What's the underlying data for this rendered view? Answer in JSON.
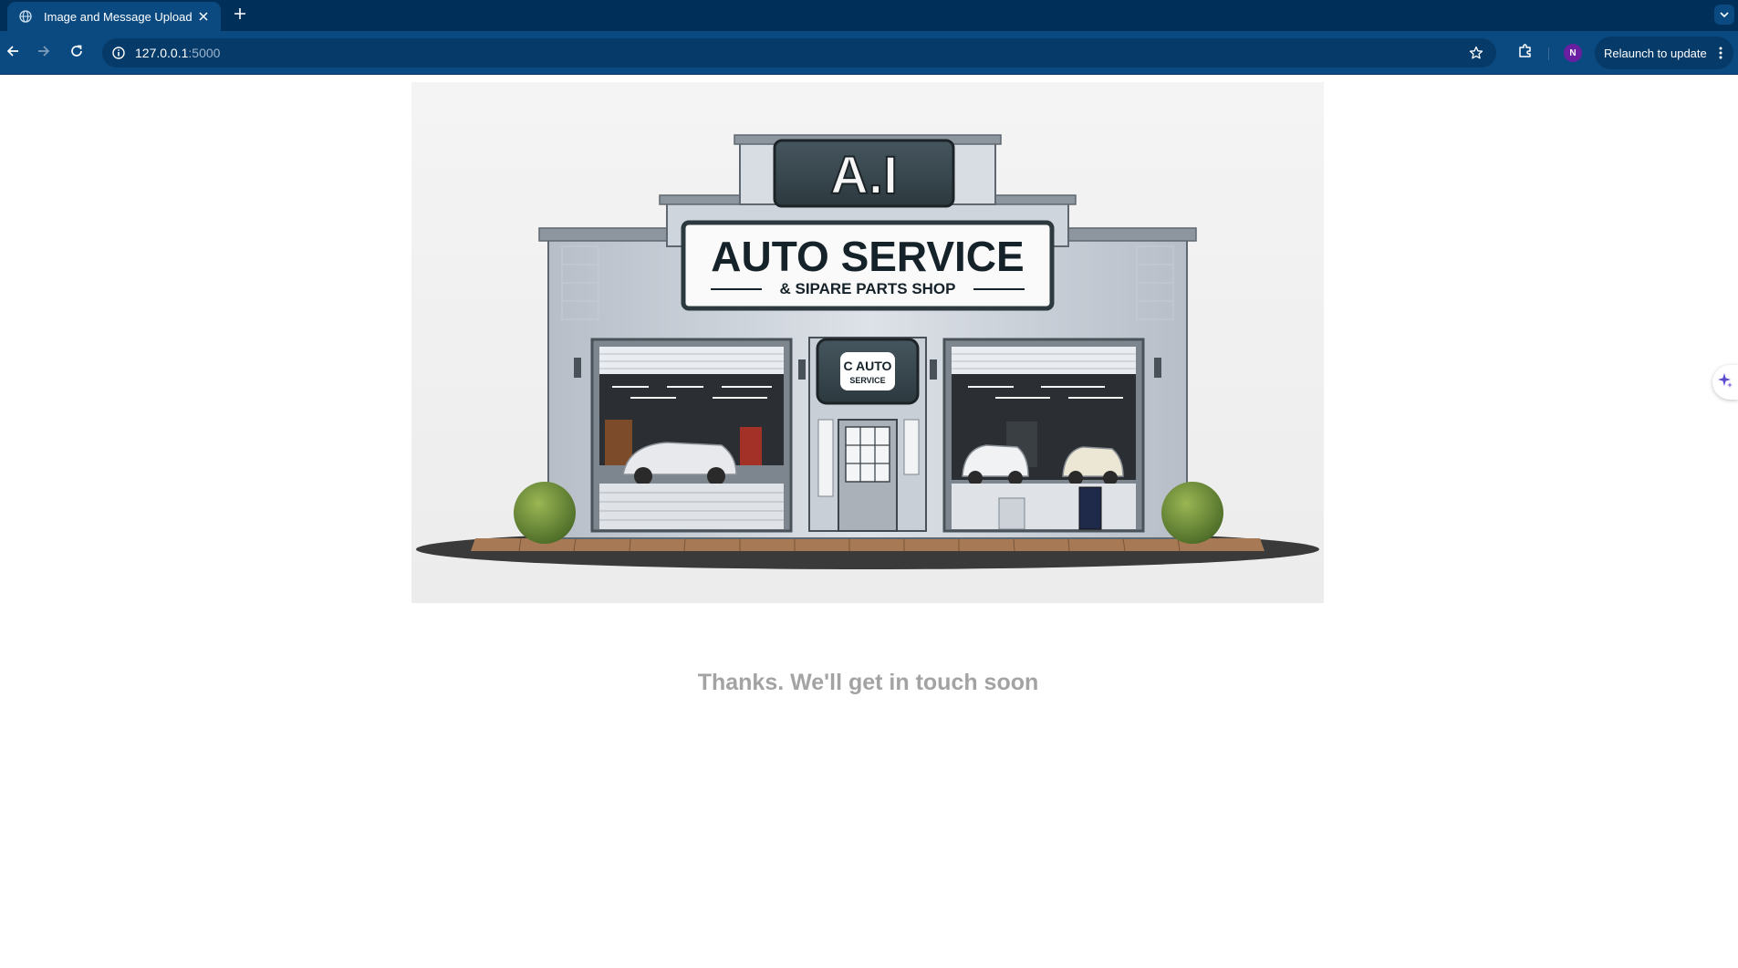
{
  "browser": {
    "tab": {
      "title": "Image and Message Upload",
      "favicon": "globe-icon",
      "close_icon": "close-icon"
    },
    "new_tab_icon": "plus-icon",
    "tab_search_icon": "chevron-down-icon",
    "nav": {
      "back_icon": "arrow-left-icon",
      "forward_icon": "arrow-right-icon",
      "reload_icon": "reload-icon"
    },
    "address_bar": {
      "host": "127.0.0.1",
      "port": ":5000",
      "site_info_icon": "info-icon",
      "bookmark_icon": "star-icon"
    },
    "extensions_icon": "puzzle-icon",
    "profile_initial": "N",
    "relaunch_label": "Relaunch to update",
    "menu_icon": "kebab-menu-icon"
  },
  "page": {
    "hero_image": {
      "description_icon": "auto-service-storefront-image",
      "sign_top": "A.I",
      "sign_main": "AUTO SERVICE",
      "sign_sub": "& SIPARE PARTS SHOP",
      "badge_line1": "C AUTO",
      "badge_line2": "SERVICE"
    },
    "message": "Thanks. We'll get in touch soon",
    "side_panel_icon": "sparkle-icon"
  },
  "colors": {
    "tabbar": "#00305a",
    "toolbar": "#0a4a80",
    "message_text": "#a3a3a3",
    "avatar": "#6a1fa1"
  }
}
